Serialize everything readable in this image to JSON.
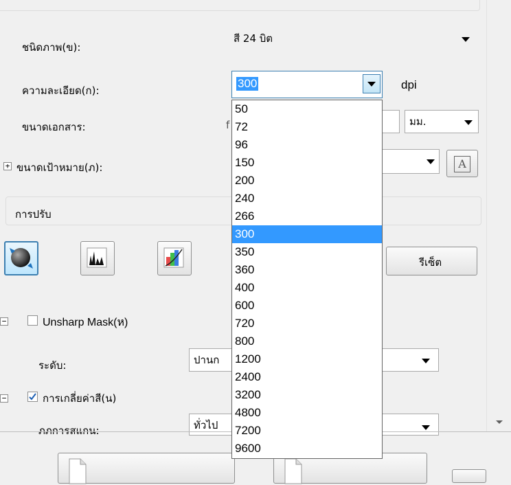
{
  "image_type": {
    "label": "ชนิดภาพ(ข):",
    "value": "สี 24 บิต"
  },
  "resolution": {
    "label": "ความละเอียด(ก):",
    "value": "300",
    "unit": "dpi",
    "options": [
      "50",
      "72",
      "96",
      "150",
      "200",
      "240",
      "266",
      "300",
      "350",
      "360",
      "400",
      "600",
      "720",
      "800",
      "1200",
      "2400",
      "3200",
      "4800",
      "7200",
      "9600"
    ],
    "selected_index": 7
  },
  "document_size": {
    "label": "ขนาดเอกสาร:",
    "partial_text": "f",
    "unit": "มม."
  },
  "target_size": {
    "expander": "+",
    "label": "ขนาดเป้าหมาย(ภ):"
  },
  "adjustments": {
    "title": "การปรับ",
    "reset_label": "รีเซ็ต"
  },
  "unsharp": {
    "expander": "−",
    "label": "Unsharp Mask(ห)",
    "checked": false,
    "level_label": "ระดับ:",
    "level_value": "ปานก"
  },
  "color_restore": {
    "expander": "−",
    "label": "การเกลี่ยค่าสี(น)",
    "checked": true,
    "mode_label": "ภภการสแกน:",
    "mode_value": "ทั่วไป"
  }
}
